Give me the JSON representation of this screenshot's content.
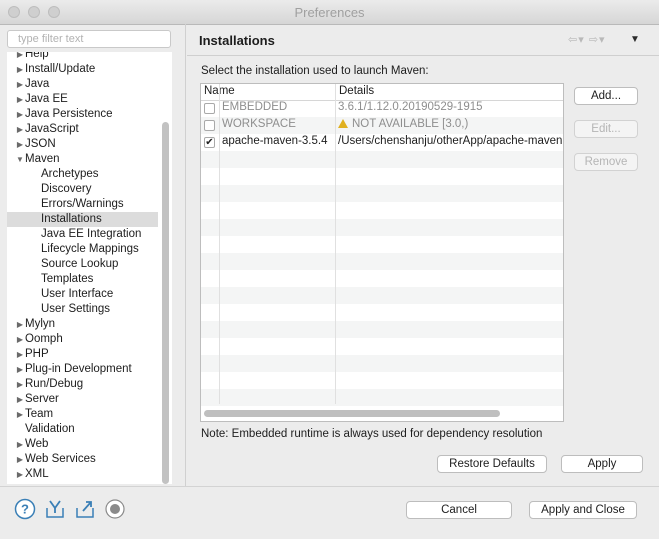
{
  "window": {
    "title": "Preferences"
  },
  "sidebar": {
    "filter_placeholder": "type filter text",
    "items": [
      {
        "label": "Help",
        "expand": "collapsed"
      },
      {
        "label": "Install/Update",
        "expand": "collapsed"
      },
      {
        "label": "Java",
        "expand": "collapsed"
      },
      {
        "label": "Java EE",
        "expand": "collapsed"
      },
      {
        "label": "Java Persistence",
        "expand": "collapsed"
      },
      {
        "label": "JavaScript",
        "expand": "collapsed"
      },
      {
        "label": "JSON",
        "expand": "collapsed"
      },
      {
        "label": "Maven",
        "expand": "expanded"
      },
      {
        "label": "Archetypes",
        "expand": "none"
      },
      {
        "label": "Discovery",
        "expand": "none"
      },
      {
        "label": "Errors/Warnings",
        "expand": "none"
      },
      {
        "label": "Installations",
        "expand": "none",
        "selected": true
      },
      {
        "label": "Java EE Integration",
        "expand": "none"
      },
      {
        "label": "Lifecycle Mappings",
        "expand": "none"
      },
      {
        "label": "Source Lookup",
        "expand": "none"
      },
      {
        "label": "Templates",
        "expand": "none"
      },
      {
        "label": "User Interface",
        "expand": "none"
      },
      {
        "label": "User Settings",
        "expand": "none"
      },
      {
        "label": "Mylyn",
        "expand": "collapsed"
      },
      {
        "label": "Oomph",
        "expand": "collapsed"
      },
      {
        "label": "PHP",
        "expand": "collapsed"
      },
      {
        "label": "Plug-in Development",
        "expand": "collapsed"
      },
      {
        "label": "Run/Debug",
        "expand": "collapsed"
      },
      {
        "label": "Server",
        "expand": "collapsed"
      },
      {
        "label": "Team",
        "expand": "collapsed"
      },
      {
        "label": "Validation",
        "expand": "none"
      },
      {
        "label": "Web",
        "expand": "collapsed"
      },
      {
        "label": "Web Services",
        "expand": "collapsed"
      },
      {
        "label": "XML",
        "expand": "collapsed"
      }
    ]
  },
  "page": {
    "title": "Installations",
    "prompt": "Select the installation used to launch Maven:",
    "table": {
      "columns": [
        "Name",
        "Details"
      ],
      "rows": [
        {
          "name": "EMBEDDED",
          "details": "3.6.1/1.12.0.20190529-1915",
          "checked": false,
          "dim": true,
          "warning": false
        },
        {
          "name": "WORKSPACE",
          "details": "NOT AVAILABLE [3.0,)",
          "checked": false,
          "dim": true,
          "warning": true
        },
        {
          "name": "apache-maven-3.5.4",
          "details": "/Users/chenshanju/otherApp/apache-maven",
          "checked": true,
          "dim": false,
          "warning": false
        }
      ]
    },
    "buttons": {
      "add": "Add...",
      "edit": "Edit...",
      "remove": "Remove"
    },
    "note": "Note: Embedded runtime is always used for dependency resolution",
    "restore_defaults": "Restore Defaults",
    "apply": "Apply"
  },
  "footer": {
    "cancel": "Cancel",
    "apply_and_close": "Apply and Close"
  },
  "icons": {
    "check": "✔",
    "triangle_collapsed": "▶",
    "triangle_expanded": "▼",
    "nav_back": "⇦▾",
    "nav_forward": "⇨▾",
    "view_menu": "▼"
  },
  "colors": {
    "selection": "#dcdcdc",
    "warning": "#e0b020",
    "link_icon": "#3a7fb6"
  }
}
